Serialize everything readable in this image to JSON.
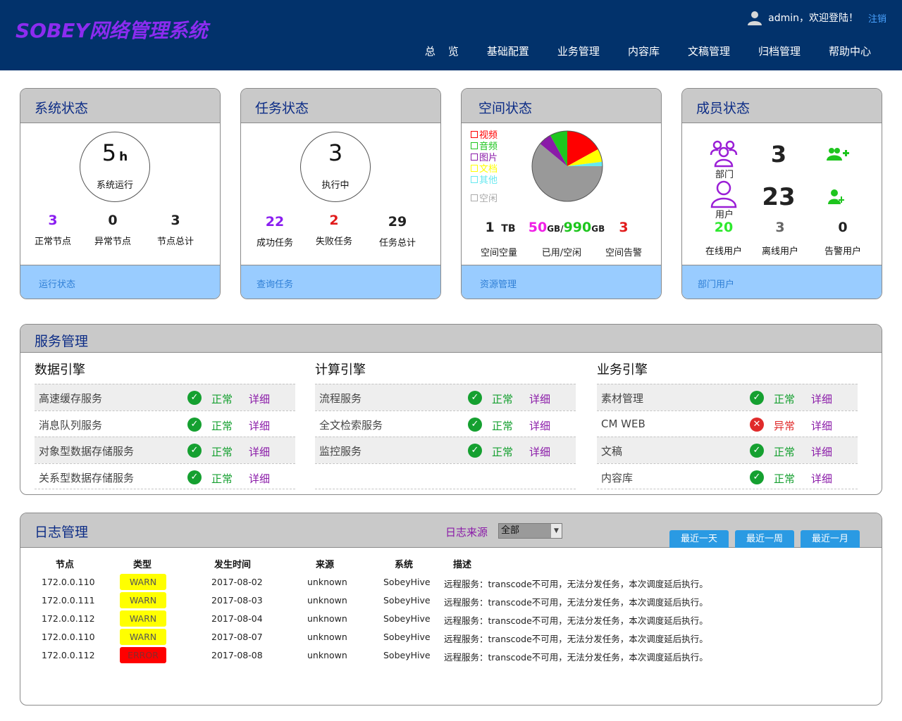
{
  "header": {
    "logo": "SOBEY网络管理系统",
    "welcome": "admin，欢迎登陆！",
    "logout": "注销",
    "nav": [
      "总览",
      "基础配置",
      "业务管理",
      "内容库",
      "文稿管理",
      "归档管理",
      "帮助中心"
    ]
  },
  "system_status": {
    "title": "系统状态",
    "uptime_value": "5",
    "uptime_unit": "h",
    "uptime_label": "系统运行",
    "stats": [
      {
        "value": "3",
        "label": "正常节点",
        "color": "#8a1ef0"
      },
      {
        "value": "0",
        "label": "异常节点",
        "color": "#111111"
      },
      {
        "value": "3",
        "label": "节点总计",
        "color": "#111111"
      }
    ],
    "footer_link": "运行状态"
  },
  "task_status": {
    "title": "任务状态",
    "running_value": "3",
    "running_label": "执行中",
    "stats": [
      {
        "value": "22",
        "label": "成功任务",
        "color": "#8a1ef0"
      },
      {
        "value": "2",
        "label": "失败任务",
        "color": "#e11b1b"
      },
      {
        "value": "29",
        "label": "任务总计",
        "color": "#111111"
      }
    ],
    "footer_link": "查询任务"
  },
  "space_status": {
    "title": "空间状态",
    "legend": [
      {
        "label": "视频",
        "color": "#ff0000"
      },
      {
        "label": "音频",
        "color": "#1ec51e"
      },
      {
        "label": "图片",
        "color": "#8a1aa8"
      },
      {
        "label": "文档",
        "color": "#ffff00"
      },
      {
        "label": "其他",
        "color": "#66e8f0"
      },
      {
        "label": "空闲",
        "color": "#aaaaaa"
      }
    ],
    "pie": [
      {
        "label": "视频",
        "fraction": 0.17,
        "color": "#ff0000"
      },
      {
        "label": "文档",
        "fraction": 0.06,
        "color": "#ffff00"
      },
      {
        "label": "其他",
        "fraction": 0.02,
        "color": "#66e8f0"
      },
      {
        "label": "空闲",
        "fraction": 0.61,
        "color": "#999999"
      },
      {
        "label": "图片",
        "fraction": 0.06,
        "color": "#8a1aa8"
      },
      {
        "label": "音频",
        "fraction": 0.08,
        "color": "#1ec51e"
      }
    ],
    "total_value": "1",
    "total_unit": "TB",
    "used_value": "50",
    "used_unit": "GB",
    "separator": "/",
    "free_value": "990",
    "free_unit": "GB",
    "alarm_value": "3",
    "labels": [
      "空间空量",
      "已用/空闲",
      "空间告警"
    ],
    "footer_link": "资源管理"
  },
  "member_status": {
    "title": "成员状态",
    "dept_label": "部门",
    "dept_count": "3",
    "user_label": "用户",
    "user_count": "23",
    "stats": [
      {
        "value": "20",
        "label": "在线用户",
        "color": "#2ee82e"
      },
      {
        "value": "3",
        "label": "离线用户",
        "color": "#666666"
      },
      {
        "value": "0",
        "label": "告警用户",
        "color": "#111111"
      }
    ],
    "footer_link": "部门用户"
  },
  "services": {
    "title": "服务管理",
    "columns": [
      {
        "title": "数据引擎",
        "rows": [
          {
            "name": "高速缓存服务",
            "status": "正常",
            "ok": true,
            "detail": "详细"
          },
          {
            "name": "消息队列服务",
            "status": "正常",
            "ok": true,
            "detail": "详细"
          },
          {
            "name": "对象型数据存储服务",
            "status": "正常",
            "ok": true,
            "detail": "详细"
          },
          {
            "name": "关系型数据存储服务",
            "status": "正常",
            "ok": true,
            "detail": "详细"
          }
        ]
      },
      {
        "title": "计算引擎",
        "rows": [
          {
            "name": "流程服务",
            "status": "正常",
            "ok": true,
            "detail": "详细"
          },
          {
            "name": "全文检索服务",
            "status": "正常",
            "ok": true,
            "detail": "详细"
          },
          {
            "name": "监控服务",
            "status": "正常",
            "ok": true,
            "detail": "详细"
          }
        ]
      },
      {
        "title": "业务引擎",
        "rows": [
          {
            "name": "素材管理",
            "status": "正常",
            "ok": true,
            "detail": "详细"
          },
          {
            "name": "CM WEB",
            "status": "异常",
            "ok": false,
            "detail": "详细"
          },
          {
            "name": "文稿",
            "status": "正常",
            "ok": true,
            "detail": "详细"
          },
          {
            "name": "内容库",
            "status": "正常",
            "ok": true,
            "detail": "详细"
          }
        ]
      }
    ]
  },
  "logs": {
    "title": "日志管理",
    "filter_label": "日志来源",
    "filter_value": "全部",
    "buttons": [
      "最近一天",
      "最近一周",
      "最近一月"
    ],
    "headers": [
      "节点",
      "类型",
      "发生时间",
      "来源",
      "系统",
      "描述"
    ],
    "rows": [
      {
        "node": "172.0.0.110",
        "type": "WARN",
        "time": "2017-08-02",
        "source": "unknown",
        "system": "SobeyHive",
        "desc": "远程服务：transcode不可用，无法分发任务，本次调度延后执行。"
      },
      {
        "node": "172.0.0.111",
        "type": "WARN",
        "time": "2017-08-03",
        "source": "unknown",
        "system": "SobeyHive",
        "desc": "远程服务：transcode不可用，无法分发任务，本次调度延后执行。"
      },
      {
        "node": "172.0.0.112",
        "type": "WARN",
        "time": "2017-08-04",
        "source": "unknown",
        "system": "SobeyHive",
        "desc": "远程服务：transcode不可用，无法分发任务，本次调度延后执行。"
      },
      {
        "node": "172.0.0.110",
        "type": "WARN",
        "time": "2017-08-07",
        "source": "unknown",
        "system": "SobeyHive",
        "desc": "远程服务：transcode不可用，无法分发任务，本次调度延后执行。"
      },
      {
        "node": "172.0.0.112",
        "type": "ERROR",
        "time": "2017-08-08",
        "source": "unknown",
        "system": "SobeyHive",
        "desc": "远程服务：transcode不可用，无法分发任务，本次调度延后执行。"
      }
    ],
    "type_colors": {
      "WARN": "#ffff00",
      "ERROR": "#ff0000"
    }
  }
}
